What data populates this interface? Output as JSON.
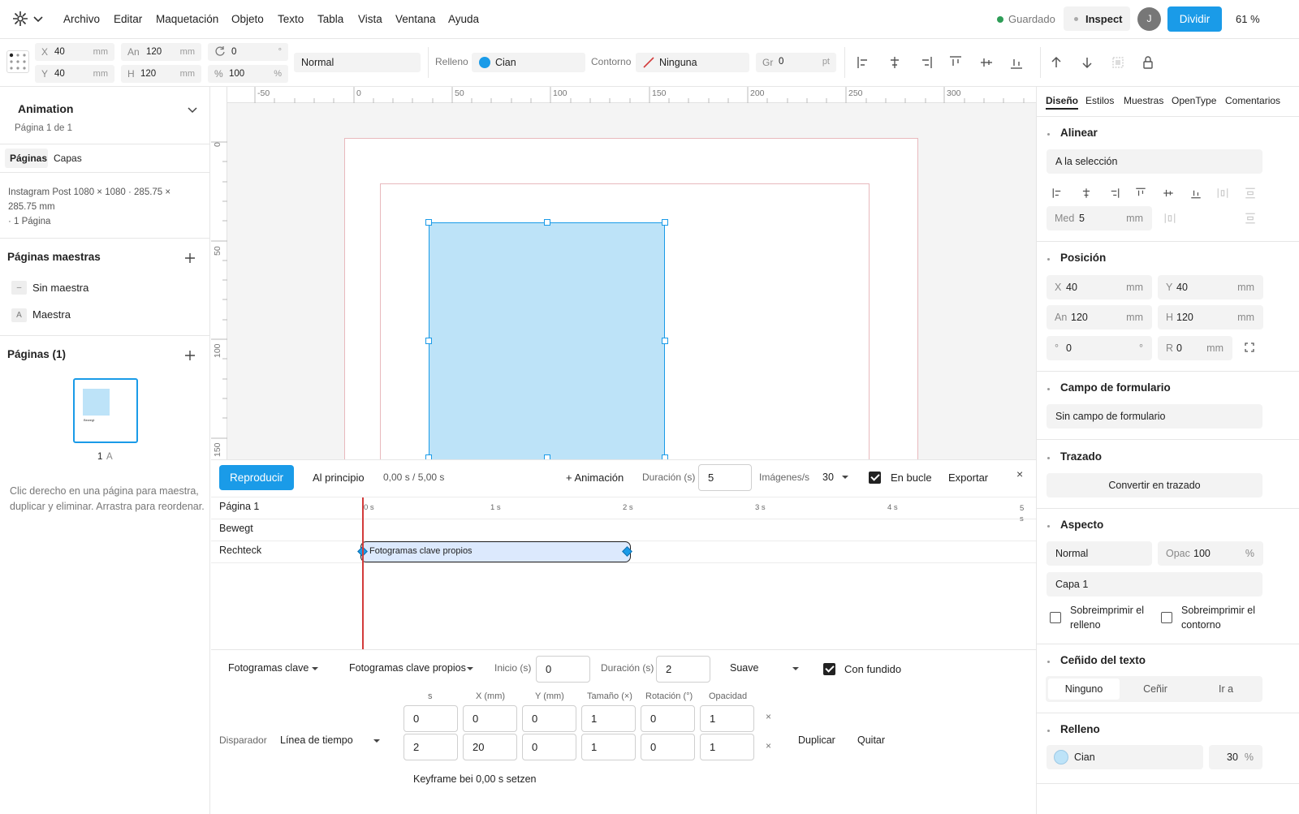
{
  "menubar": {
    "items": [
      "Archivo",
      "Editar",
      "Maquetación",
      "Objeto",
      "Texto",
      "Tabla",
      "Vista",
      "Ventana",
      "Ayuda"
    ],
    "saved": "Guardado",
    "inspect": "Inspect",
    "avatar": "J",
    "split_button": "Dividir",
    "zoom": "61 %"
  },
  "toolbar": {
    "x": {
      "label": "X",
      "value": "40",
      "unit": "mm"
    },
    "y": {
      "label": "Y",
      "value": "40",
      "unit": "mm"
    },
    "w": {
      "label": "An",
      "value": "120",
      "unit": "mm"
    },
    "h": {
      "label": "H",
      "value": "120",
      "unit": "mm"
    },
    "rotation": {
      "value": "0",
      "unit": "°"
    },
    "scale": {
      "label": "%",
      "value": "100",
      "unit": "%"
    },
    "blend": "Normal",
    "fill_label": "Relleno",
    "fill_value": "Cian",
    "stroke_label": "Contorno",
    "stroke_value": "Ninguna",
    "weight": {
      "label": "Gr",
      "value": "0",
      "unit": "pt"
    }
  },
  "left": {
    "doc_title": "Animation",
    "doc_sub": "Página 1 de 1",
    "tabs": [
      "Páginas",
      "Capas"
    ],
    "doc_info": "Instagram Post 1080 × 1080 · 285.75 × 285.75 mm",
    "doc_pages": "· 1 Página",
    "masters_title": "Páginas maestras",
    "masters": [
      {
        "badge": "–",
        "label": "Sin maestra"
      },
      {
        "badge": "A",
        "label": "Maestra"
      }
    ],
    "pages_title": "Páginas (1)",
    "thumb_text": "Bewegt",
    "page_num": "1",
    "page_master": "A",
    "hint": "Clic derecho en una página para maestra, duplicar y eliminar. Arrastra para reordenar."
  },
  "ruler": {
    "h": [
      "-50",
      "0",
      "50",
      "100",
      "150",
      "200",
      "250",
      "300"
    ],
    "v": [
      "0",
      "50",
      "100",
      "150"
    ]
  },
  "timeline": {
    "play": "Reproducir",
    "to_start": "Al principio",
    "time": "0,00 s / 5,00 s",
    "add_anim": "+ Animación",
    "duration_label": "Duración (s)",
    "duration": "5",
    "fps_label": "Imágenes/s",
    "fps": "30",
    "loop": "En bucle",
    "export": "Exportar",
    "close": "×",
    "rows": [
      "Página 1",
      "Bewegt",
      "Rechteck"
    ],
    "ticks": [
      "0 s",
      "1 s",
      "2 s",
      "3 s",
      "4 s",
      "5 s"
    ],
    "clip_label": "Fotogramas clave propios"
  },
  "keyframes": {
    "type": "Fotogramas clave",
    "preset": "Fotogramas clave propios",
    "start_label": "Inicio (s)",
    "start": "0",
    "dur_label": "Duración (s)",
    "dur": "2",
    "easing": "Suave",
    "fade": "Con fundido",
    "columns": [
      "s",
      "X (mm)",
      "Y (mm)",
      "Tamaño (×)",
      "Rotación (°)",
      "Opacidad"
    ],
    "rows": [
      [
        "0",
        "0",
        "0",
        "1",
        "0",
        "1"
      ],
      [
        "2",
        "20",
        "0",
        "1",
        "0",
        "1"
      ]
    ],
    "remove_x": "×",
    "trigger_label": "Disparador",
    "trigger": "Línea de tiempo",
    "duplicate": "Duplicar",
    "remove": "Quitar",
    "set_kf": "Keyframe bei 0,00 s setzen"
  },
  "right": {
    "tabs": [
      "Diseño",
      "Estilos",
      "Muestras",
      "OpenType",
      "Comentarios"
    ],
    "align_title": "Alinear",
    "align_to": "A la selección",
    "spacing": {
      "label": "Med",
      "value": "5",
      "unit": "mm"
    },
    "position_title": "Posición",
    "x": {
      "label": "X",
      "value": "40",
      "unit": "mm"
    },
    "y": {
      "label": "Y",
      "value": "40",
      "unit": "mm"
    },
    "w": {
      "label": "An",
      "value": "120",
      "unit": "mm"
    },
    "h": {
      "label": "H",
      "value": "120",
      "unit": "mm"
    },
    "rot": {
      "label": "°",
      "value": "0",
      "unit": "°"
    },
    "radius": {
      "label": "R",
      "value": "0",
      "unit": "mm"
    },
    "form_title": "Campo de formulario",
    "form_value": "Sin campo de formulario",
    "path_title": "Trazado",
    "path_button": "Convertir en trazado",
    "appearance_title": "Aspecto",
    "blend": "Normal",
    "opacity": {
      "label": "Opac",
      "value": "100",
      "unit": "%"
    },
    "layer": "Capa 1",
    "overprint_fill": "Sobreimprimir el relleno",
    "overprint_stroke": "Sobreimprimir el contorno",
    "wrap_title": "Ceñido del texto",
    "wrap_options": [
      "Ninguno",
      "Ceñir",
      "Ir a"
    ],
    "fill_title": "Relleno",
    "fill_value": "Cian",
    "fill_pct": "30",
    "fill_unit": "%"
  },
  "colors": {
    "accent": "#1a9be8",
    "shape_fill": "#bde3f8",
    "shape_stroke": "#1a9be8",
    "playhead": "#d33b3b"
  }
}
